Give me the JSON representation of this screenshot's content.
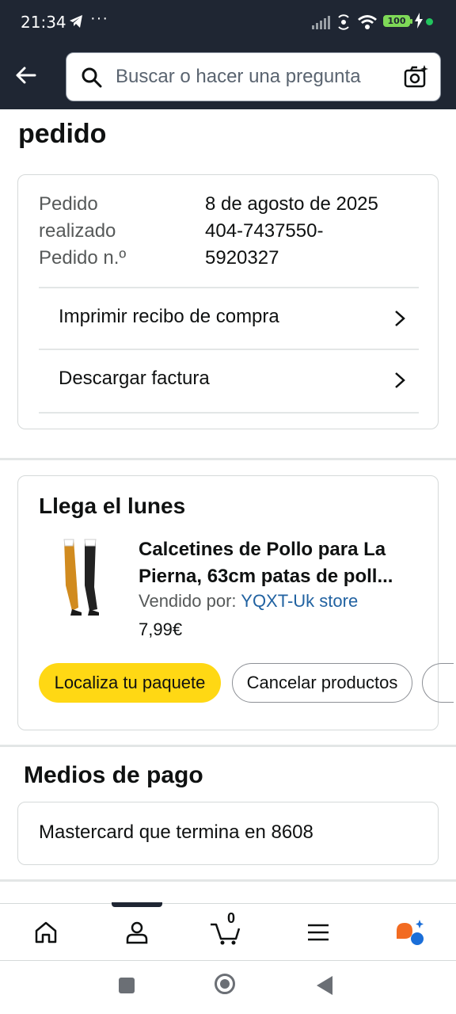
{
  "status_bar": {
    "time": "21:34",
    "dots": "···",
    "battery": "100"
  },
  "search": {
    "placeholder": "Buscar o hacer una pregunta"
  },
  "page_title": "pedido",
  "order": {
    "placed_label_1": "Pedido",
    "placed_label_2": "realizado",
    "placed_value": "8 de agosto de 2025",
    "number_label": "Pedido n.º",
    "number_value_1": "404-7437550-",
    "number_value_2": "5920327",
    "print_receipt": "Imprimir recibo de compra",
    "download_invoice": "Descargar factura"
  },
  "shipment": {
    "title": "Llega el lunes",
    "product_name_line1": "Calcetines de Pollo para La",
    "product_name_line2": "Pierna, 63cm patas de poll...",
    "seller_label": "Vendido por: ",
    "seller_name": "YQXT-Uk store",
    "price": "7,99€",
    "track_button": "Localiza tu paquete",
    "cancel_button": "Cancelar productos"
  },
  "payment": {
    "title": "Medios de pago",
    "method": "Mastercard que termina en 8608"
  },
  "bottom_nav": {
    "cart_count": "0"
  },
  "colors": {
    "header_bg": "#1f2633",
    "accent_yellow": "#ffd814",
    "link_blue": "#2162a1"
  }
}
